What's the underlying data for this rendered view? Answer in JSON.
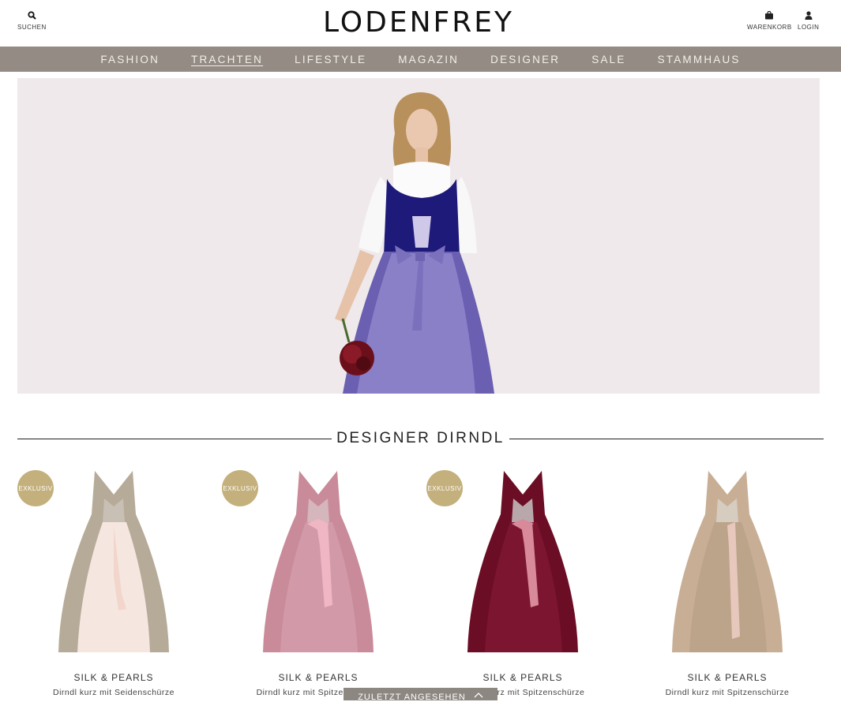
{
  "header": {
    "logo": "LODENFREY",
    "search_label": "SUCHEN",
    "cart_label": "WARENKORB",
    "login_label": "LOGIN"
  },
  "nav": {
    "items": [
      "FASHION",
      "TRACHTEN",
      "LIFESTYLE",
      "MAGAZIN",
      "DESIGNER",
      "SALE",
      "STAMMHAUS"
    ],
    "active": "TRACHTEN"
  },
  "section": {
    "title": "DESIGNER DIRNDL"
  },
  "products": [
    {
      "badge": "EXKLUSIV",
      "brand": "SILK & PEARLS",
      "description": "Dirndl kurz mit Seidenschürze"
    },
    {
      "badge": "EXKLUSIV",
      "brand": "SILK & PEARLS",
      "description": "Dirndl kurz mit Spitzenschürze"
    },
    {
      "badge": "EXKLUSIV",
      "brand": "SILK & PEARLS",
      "description": "Dirndl kurz mit Spitzenschürze"
    },
    {
      "badge": "",
      "brand": "SILK & PEARLS",
      "description": "Dirndl kurz mit Spitzenschürze"
    }
  ],
  "recently_viewed": {
    "label": "ZULETZT ANGESEHEN"
  },
  "colors": {
    "nav_bg": "#938b84",
    "badge_bg": "#c4b07c",
    "hero_bg": "#efe9ec"
  }
}
